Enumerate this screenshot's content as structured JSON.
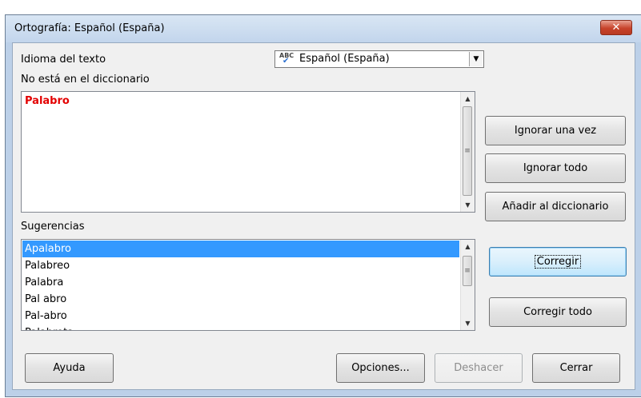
{
  "window": {
    "title": "Ortografía: Español (España)",
    "close_icon": "close-icon"
  },
  "language": {
    "label": "Idioma del texto",
    "value": "Español (España)",
    "icon": "spellcheck-abc-icon"
  },
  "not_in_dict": {
    "label": "No está en el diccionario",
    "word": "Palabro"
  },
  "suggestions": {
    "label": "Sugerencias",
    "items": [
      "Apalabro",
      "Palabreo",
      "Palabra",
      "Pal abro",
      "Pal-abro",
      "Palabrota"
    ],
    "selected_index": 0
  },
  "buttons": {
    "ignore_once": "Ignorar una vez",
    "ignore_all": "Ignorar todo",
    "add_to_dict": "Añadir al diccionario",
    "correct": "Corregir",
    "correct_all": "Corregir todo",
    "help": "Ayuda",
    "options": "Opciones...",
    "undo": "Deshacer",
    "close": "Cerrar"
  }
}
